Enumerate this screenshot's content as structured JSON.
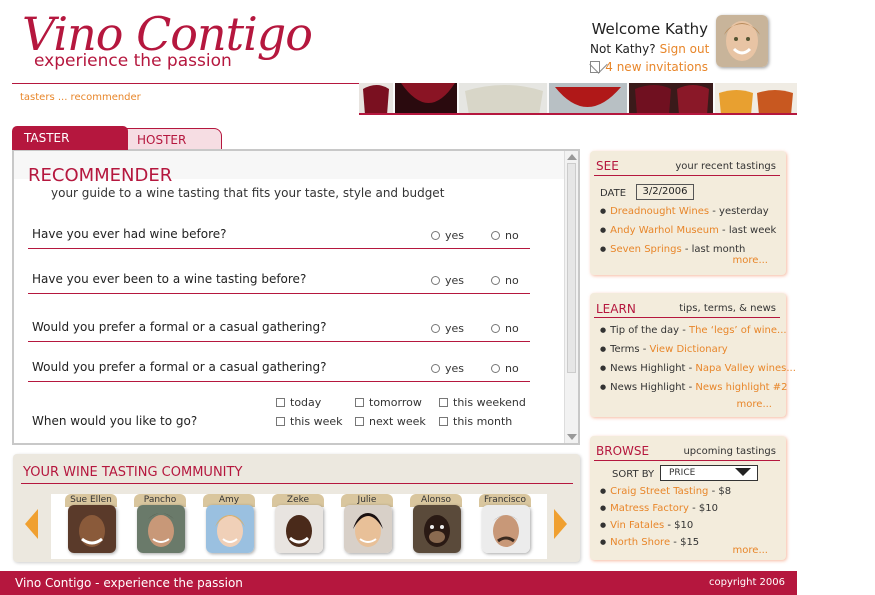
{
  "brand": {
    "title": "Vino Contigo",
    "tagline": "experience the passion"
  },
  "user": {
    "welcome": "Welcome Kathy",
    "not_user": "Not Kathy?",
    "sign_out": "Sign out",
    "invitations": "4 new invitations"
  },
  "breadcrumb": "tasters ... recommender",
  "tabs": [
    {
      "label": "TASTER",
      "active": true
    },
    {
      "label": "HOSTER",
      "active": false
    }
  ],
  "recommender": {
    "title": "RECOMMENDER",
    "subtitle": "your guide to a wine tasting that fits your taste, style and budget",
    "questions": [
      {
        "text": "Have you ever had wine before?",
        "yes": "yes",
        "no": "no"
      },
      {
        "text": "Have you ever been to a wine tasting before?",
        "yes": "yes",
        "no": "no"
      },
      {
        "text": "Would you prefer a formal or a casual gathering?",
        "yes": "yes",
        "no": "no"
      },
      {
        "text": "Would you prefer a formal or a casual gathering?",
        "yes": "yes",
        "no": "no"
      }
    ],
    "when": {
      "text": "When would you like to go?",
      "options": [
        "today",
        "tomorrow",
        "this weekend",
        "this week",
        "next week",
        "this month"
      ]
    }
  },
  "community": {
    "title": "YOUR WINE TASTING COMMUNITY",
    "friends": [
      "Sue Ellen",
      "Pancho",
      "Amy",
      "Zeke",
      "Julie",
      "Alonso",
      "Francisco"
    ]
  },
  "see": {
    "title": "SEE",
    "subtitle": "your recent tastings",
    "date_label": "DATE",
    "date_value": "3/2/2006",
    "items": [
      {
        "link": "Dreadnought Wines",
        "rest": " - yesterday"
      },
      {
        "link": "Andy Warhol Museum",
        "rest": " - last week"
      },
      {
        "link": "Seven Springs",
        "rest": " - last month"
      }
    ],
    "more": "more..."
  },
  "learn": {
    "title": "LEARN",
    "subtitle": "tips, terms, & news",
    "items": [
      {
        "prefix": "Tip of the day - ",
        "link": "The ‘legs’ of wine..."
      },
      {
        "prefix": "Terms - ",
        "link": "View Dictionary"
      },
      {
        "prefix": "News Highlight - ",
        "link": "Napa Valley wines..."
      },
      {
        "prefix": "News Highlight - ",
        "link": " News highlight #2"
      }
    ],
    "more": "more..."
  },
  "browse": {
    "title": "BROWSE",
    "subtitle": "upcoming tastings",
    "sort_label": "SORT BY",
    "sort_value": "PRICE",
    "items": [
      {
        "link": "Craig Street Tasting",
        "rest": " - $8"
      },
      {
        "link": "Matress Factory",
        "rest": " - $10"
      },
      {
        "link": "Vin Fatales",
        "rest": " - $10"
      },
      {
        "link": "North Shore",
        "rest": " - $15"
      }
    ],
    "more": "more..."
  },
  "footer": {
    "left": "Vino Contigo - experience the passion",
    "right": "copyright 2006"
  },
  "colors": {
    "brand": "#b5173e",
    "link": "#e8862a",
    "panel": "#f3ecdc"
  }
}
